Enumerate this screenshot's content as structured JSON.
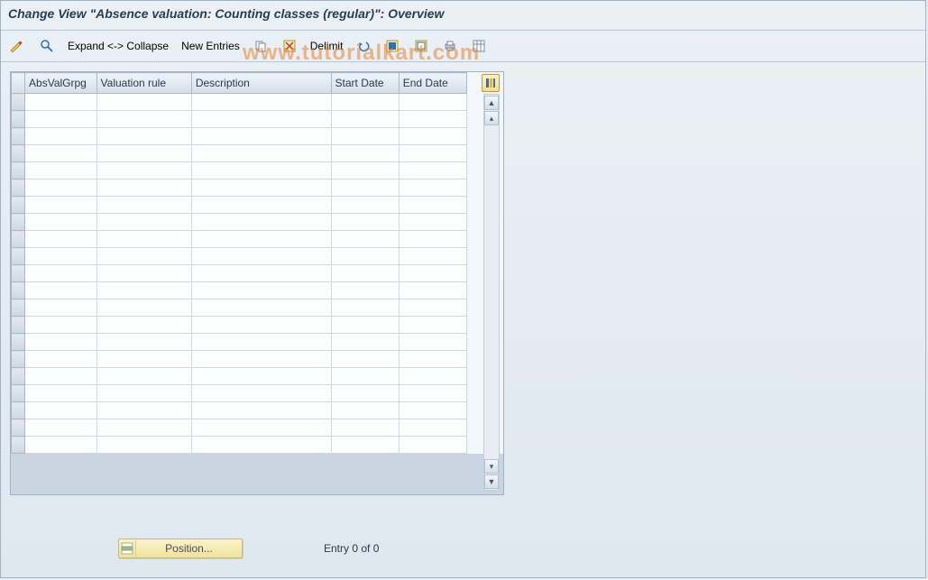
{
  "title": "Change View \"Absence valuation: Counting classes (regular)\": Overview",
  "toolbar": {
    "expand_collapse": "Expand <-> Collapse",
    "new_entries": "New Entries",
    "delimit": "Delimit"
  },
  "watermark": "www.tutorialkart.com",
  "table": {
    "columns": [
      "AbsValGrpg",
      "Valuation rule",
      "Description",
      "Start Date",
      "End Date"
    ],
    "rows": 21
  },
  "footer": {
    "position_label": "Position...",
    "entry_text": "Entry 0 of 0"
  }
}
